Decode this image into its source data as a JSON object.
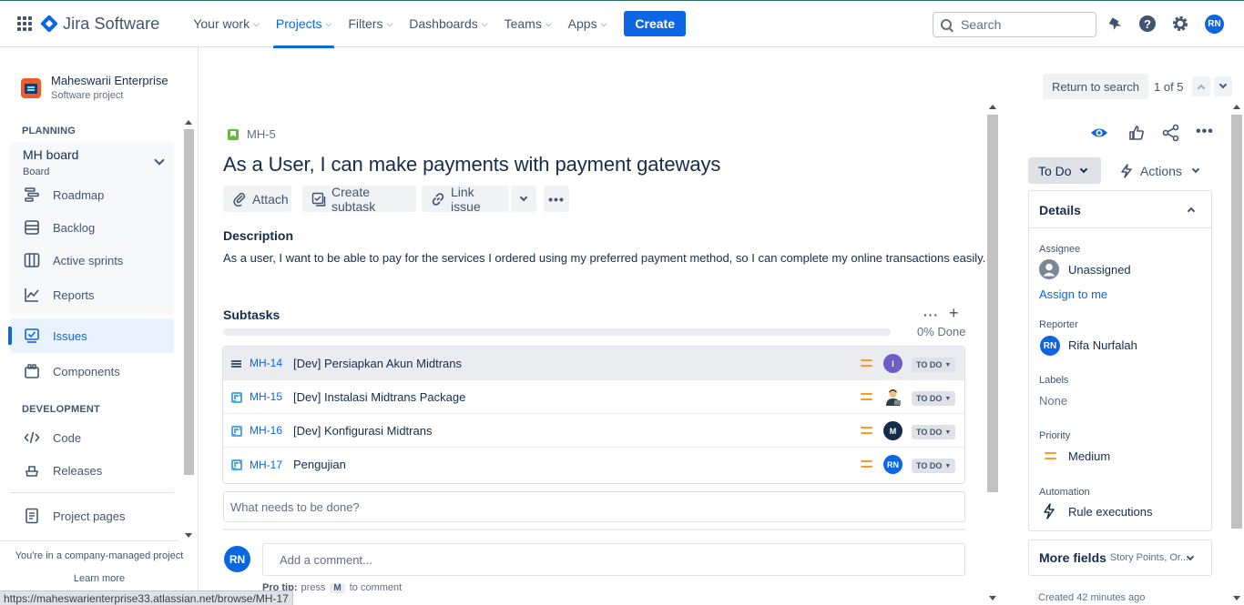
{
  "topnav": {
    "app_name": "Jira Software",
    "items": [
      {
        "label": "Your work",
        "active": false
      },
      {
        "label": "Projects",
        "active": true
      },
      {
        "label": "Filters",
        "active": false
      },
      {
        "label": "Dashboards",
        "active": false
      },
      {
        "label": "Teams",
        "active": false
      },
      {
        "label": "Apps",
        "active": false
      }
    ],
    "create_label": "Create",
    "search_placeholder": "Search",
    "user_initials": "RN",
    "icons": [
      "notifications-icon",
      "help-icon",
      "settings-icon"
    ]
  },
  "sidebar": {
    "project_name": "Maheswarii Enterprise",
    "project_type": "Software project",
    "planning_title": "PLANNING",
    "board_name": "MH board",
    "board_sub": "Board",
    "planning_items": [
      {
        "label": "Roadmap",
        "icon": "roadmap-icon"
      },
      {
        "label": "Backlog",
        "icon": "backlog-icon"
      },
      {
        "label": "Active sprints",
        "icon": "board-icon"
      },
      {
        "label": "Reports",
        "icon": "reports-icon"
      }
    ],
    "issues_label": "Issues",
    "components_label": "Components",
    "development_title": "DEVELOPMENT",
    "dev_items": [
      {
        "label": "Code",
        "icon": "code-icon"
      },
      {
        "label": "Releases",
        "icon": "releases-icon"
      }
    ],
    "project_pages_label": "Project pages",
    "footer_text": "You're in a company-managed project",
    "learn_more": "Learn more"
  },
  "issue": {
    "key": "MH-5",
    "title": "As a User, I can make payments with payment gateways",
    "toolbar": {
      "attach": "Attach",
      "create_subtask": "Create subtask",
      "link_issue": "Link issue"
    },
    "description_label": "Description",
    "description": "As a user, I want to be able to pay for the services I ordered using my preferred payment method, so I can complete my online transactions easily.",
    "subtasks_label": "Subtasks",
    "progress_percent": 0,
    "progress_text": "0% Done",
    "subtasks": [
      {
        "key": "MH-14",
        "summary": "[Dev] Persiapkan Akun Midtrans",
        "assignee": "I",
        "assignee_color": "#6e5dc6",
        "status": "TO DO"
      },
      {
        "key": "MH-15",
        "summary": "[Dev] Instalasi Midtrans Package",
        "assignee": "",
        "assignee_color": "#ffffff",
        "status": "TO DO"
      },
      {
        "key": "MH-16",
        "summary": "[Dev] Konfigurasi Midtrans",
        "assignee": "M",
        "assignee_color": "#172b4d",
        "status": "TO DO"
      },
      {
        "key": "MH-17",
        "summary": "Pengujian",
        "assignee": "RN",
        "assignee_color": "#0c66e4",
        "status": "TO DO"
      }
    ],
    "new_subtask_placeholder": "What needs to be done?",
    "commenter_initials": "RN",
    "comment_placeholder": "Add a comment...",
    "protip_label": "Pro tip:",
    "protip_press": "press",
    "protip_key": "M",
    "protip_suffix": "to comment"
  },
  "right_panel": {
    "return_to_search": "Return to search",
    "pagination": "1 of 5",
    "status": "To Do",
    "actions": "Actions",
    "details_title": "Details",
    "assignee_label": "Assignee",
    "assignee_value": "Unassigned",
    "assign_to_me": "Assign to me",
    "reporter_label": "Reporter",
    "reporter_initials": "RN",
    "reporter_name": "Rifa Nurfalah",
    "labels_label": "Labels",
    "labels_value": "None",
    "priority_label": "Priority",
    "priority_value": "Medium",
    "automation_label": "Automation",
    "automation_value": "Rule executions",
    "more_fields": "More fields",
    "more_fields_sub": "Story Points, Or...",
    "created": "Created 42 minutes ago"
  },
  "status_bar_url": "https://maheswarienterprise33.atlassian.net/browse/MH-17",
  "colors": {
    "accent": "#0c66e4",
    "priority_medium": "#ff991f",
    "story": "#63ba3c",
    "subtask": "#4bade8"
  }
}
